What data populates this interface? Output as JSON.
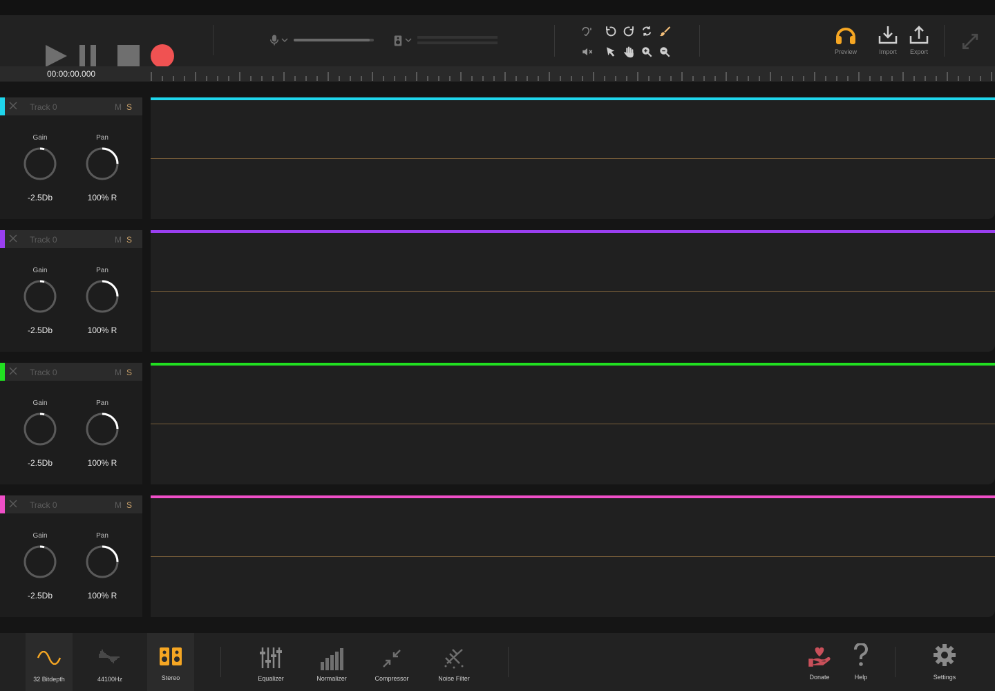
{
  "transport": {
    "play_label": "Play",
    "pause_label": "Pause",
    "stop_label": "Stop",
    "record_label": "Record"
  },
  "input": {
    "mic_volume_fraction": 0.95,
    "output_level_fraction": 0.0
  },
  "actions": {
    "preview": "Preview",
    "import": "Import",
    "export": "Export"
  },
  "timeline": {
    "time_display": "00:00:00.000"
  },
  "tracks": [
    {
      "name": "Track 0",
      "mute": "M",
      "solo": "S",
      "color": "#1fd6ec",
      "gain_label": "Gain",
      "gain_value": "-2.5Db",
      "pan_label": "Pan",
      "pan_value": "100% R"
    },
    {
      "name": "Track 0",
      "mute": "M",
      "solo": "S",
      "color": "#9a3ff0",
      "gain_label": "Gain",
      "gain_value": "-2.5Db",
      "pan_label": "Pan",
      "pan_value": "100% R"
    },
    {
      "name": "Track 0",
      "mute": "M",
      "solo": "S",
      "color": "#21e021",
      "gain_label": "Gain",
      "gain_value": "-2.5Db",
      "pan_label": "Pan",
      "pan_value": "100% R"
    },
    {
      "name": "Track 0",
      "mute": "M",
      "solo": "S",
      "color": "#f04fc8",
      "gain_label": "Gain",
      "gain_value": "-2.5Db",
      "pan_label": "Pan",
      "pan_value": "100% R"
    }
  ],
  "bottom": {
    "bitdepth": "32 Bitdepth",
    "samplerate": "44100Hz",
    "stereo": "Stereo",
    "equalizer": "Equalizer",
    "normalizer": "Normalizer",
    "compressor": "Compressor",
    "noise_filter": "Noise Filter",
    "donate": "Donate",
    "help": "Help",
    "settings": "Settings"
  },
  "colors": {
    "accent": "#f5a623",
    "record": "#f05252",
    "donate": "#c9505a"
  }
}
